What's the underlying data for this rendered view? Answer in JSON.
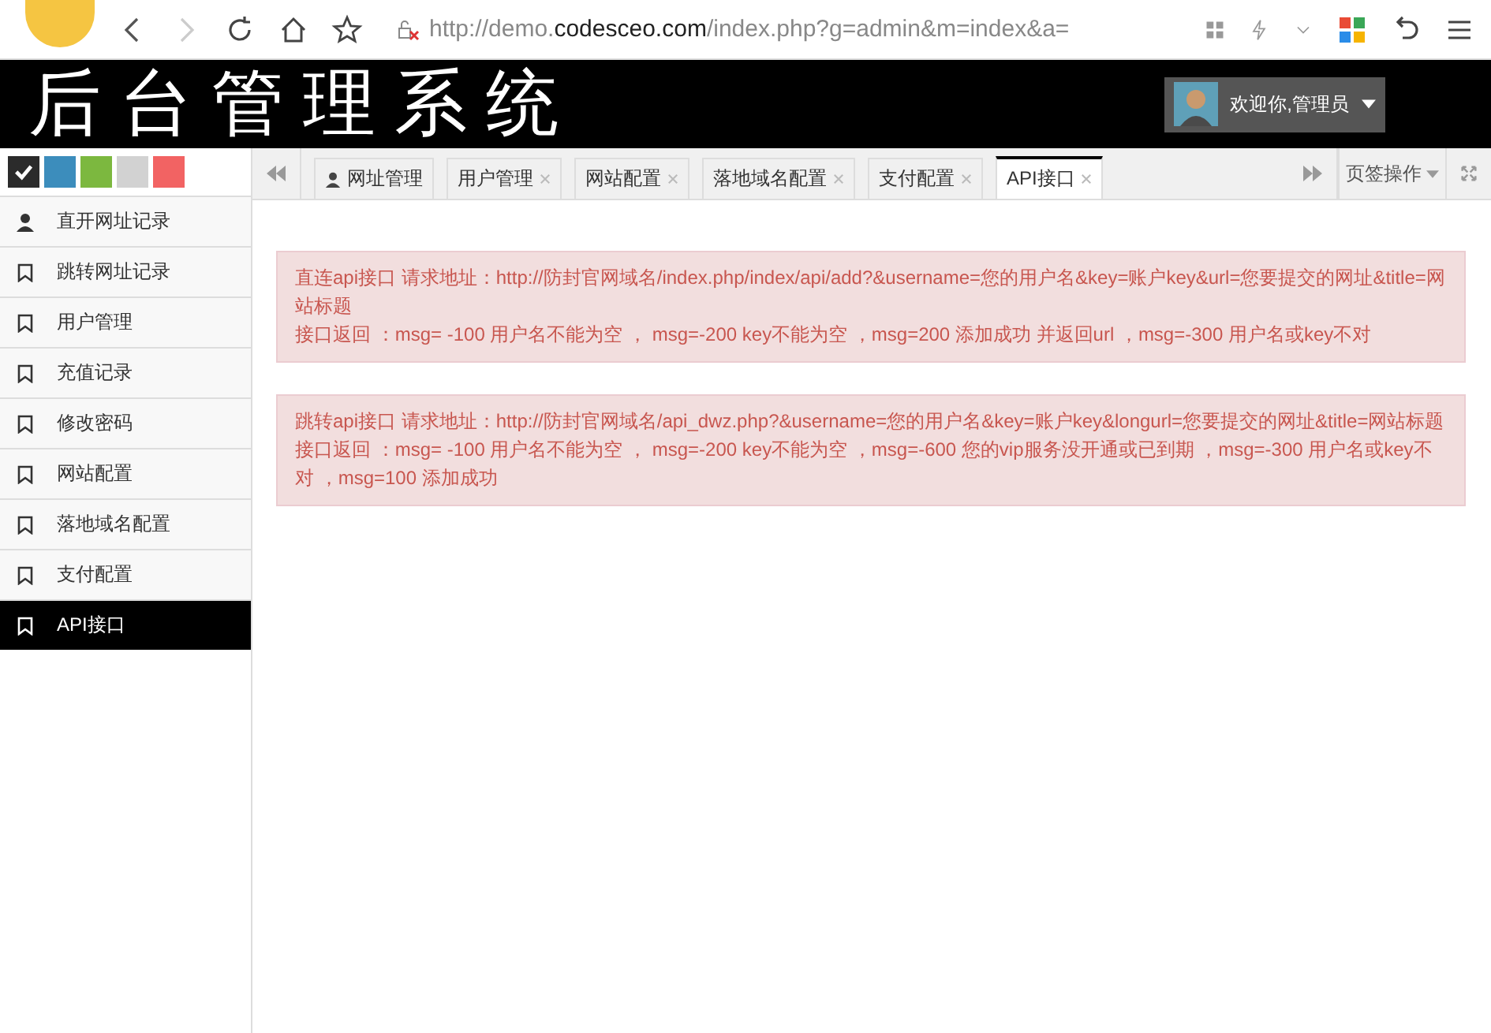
{
  "browser": {
    "url_prefix": "http://demo.",
    "url_domain": "codesceo.com",
    "url_rest": "/index.php?g=admin&m=index&a="
  },
  "header": {
    "title": "后台管理系统",
    "user": "欢迎你,管理员"
  },
  "themes": [
    {
      "color": "#2b2b2b",
      "selected": true
    },
    {
      "color": "#3c8dbc",
      "selected": false
    },
    {
      "color": "#7cb83f",
      "selected": false
    },
    {
      "color": "#d2d2d2",
      "selected": false
    },
    {
      "color": "#f26363",
      "selected": false
    }
  ],
  "sidebar": {
    "items": [
      {
        "label": "直开网址记录",
        "kind": "user",
        "selected": false
      },
      {
        "label": "跳转网址记录",
        "kind": "bookmark",
        "selected": false
      },
      {
        "label": "用户管理",
        "kind": "bookmark",
        "selected": false
      },
      {
        "label": "充值记录",
        "kind": "bookmark",
        "selected": false
      },
      {
        "label": "修改密码",
        "kind": "bookmark",
        "selected": false
      },
      {
        "label": "网站配置",
        "kind": "bookmark",
        "selected": false
      },
      {
        "label": "落地域名配置",
        "kind": "bookmark",
        "selected": false
      },
      {
        "label": "支付配置",
        "kind": "bookmark",
        "selected": false
      },
      {
        "label": "API接口",
        "kind": "bookmark",
        "selected": true
      }
    ]
  },
  "tabs": [
    {
      "label": "网址管理",
      "kind": "home",
      "selected": false
    },
    {
      "label": "用户管理",
      "kind": "closable",
      "selected": false
    },
    {
      "label": "网站配置",
      "kind": "closable",
      "selected": false
    },
    {
      "label": "落地域名配置",
      "kind": "closable",
      "selected": false
    },
    {
      "label": "支付配置",
      "kind": "closable",
      "selected": false
    },
    {
      "label": "API接口",
      "kind": "closable",
      "selected": true
    }
  ],
  "tab_actions": {
    "label": "页签操作"
  },
  "notices": [
    {
      "lines": [
        "直连api接口 请求地址：http://防封官网域名/index.php/index/api/add?&username=您的用户名&key=账户key&url=您要提交的网址&title=网站标题",
        "接口返回 ：msg= -100 用户名不能为空 ， msg=-200 key不能为空 ，msg=200 添加成功 并返回url ，msg=-300 用户名或key不对"
      ]
    },
    {
      "lines": [
        "跳转api接口 请求地址：http://防封官网域名/api_dwz.php?&username=您的用户名&key=账户key&longurl=您要提交的网址&title=网站标题",
        "接口返回 ：msg= -100 用户名不能为空 ， msg=-200 key不能为空 ，msg=-600 您的vip服务没开通或已到期 ，msg=-300 用户名或key不对 ，msg=100 添加成功"
      ]
    }
  ]
}
